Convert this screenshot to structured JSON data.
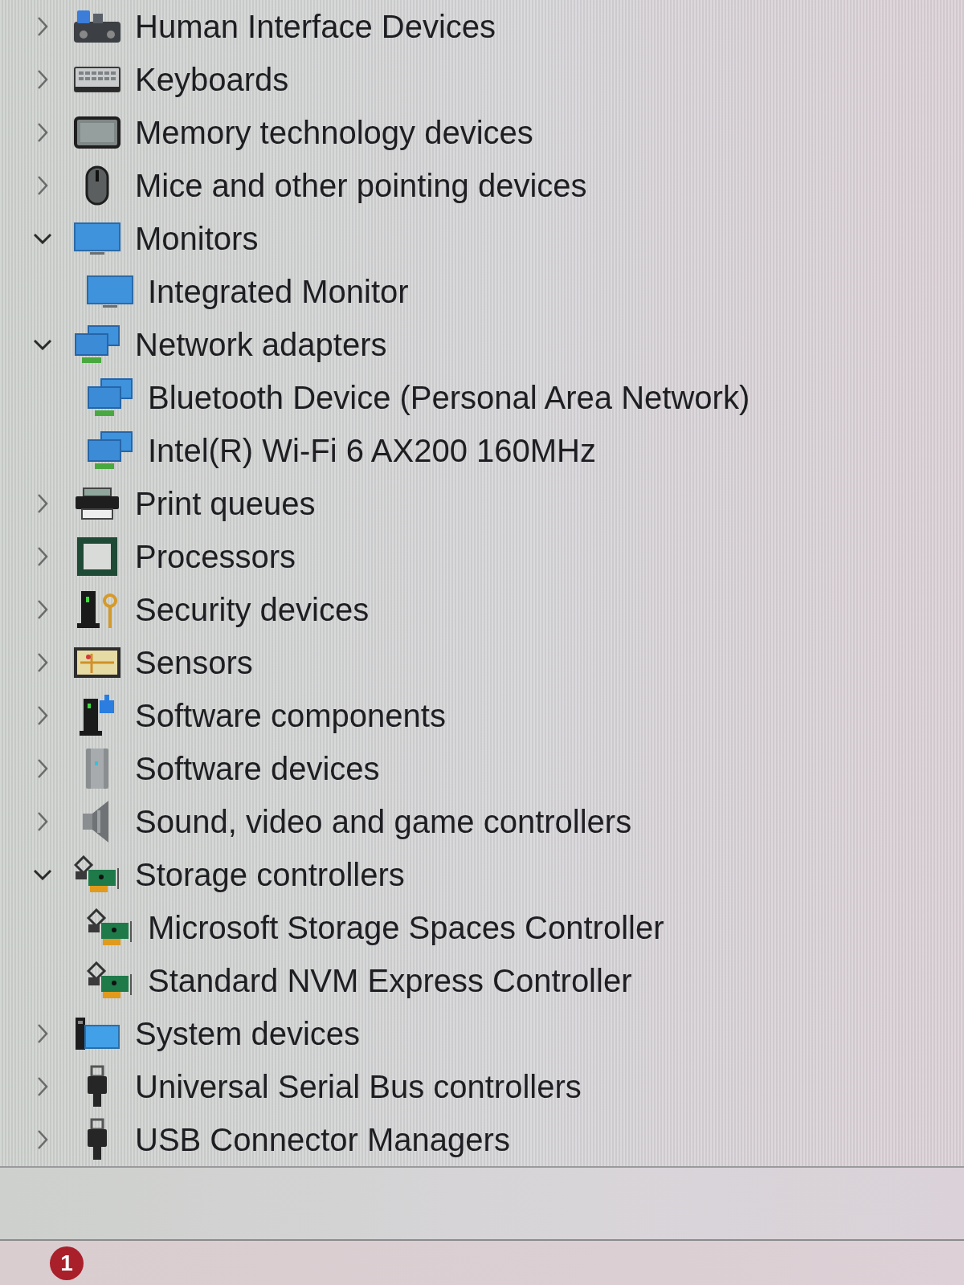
{
  "tree": {
    "items": [
      {
        "kind": "hid",
        "label": "Human Interface Devices",
        "expanded": false
      },
      {
        "kind": "keyboard",
        "label": "Keyboards",
        "expanded": false
      },
      {
        "kind": "memory",
        "label": "Memory technology devices",
        "expanded": false
      },
      {
        "kind": "mouse",
        "label": "Mice and other pointing devices",
        "expanded": false
      },
      {
        "kind": "monitor",
        "label": "Monitors",
        "expanded": true,
        "children": [
          {
            "kind": "monitor",
            "label": "Integrated Monitor"
          }
        ]
      },
      {
        "kind": "network",
        "label": "Network adapters",
        "expanded": true,
        "children": [
          {
            "kind": "network",
            "label": "Bluetooth Device (Personal Area Network)"
          },
          {
            "kind": "network",
            "label": "Intel(R) Wi-Fi 6 AX200 160MHz"
          }
        ]
      },
      {
        "kind": "printer",
        "label": "Print queues",
        "expanded": false
      },
      {
        "kind": "processor",
        "label": "Processors",
        "expanded": false
      },
      {
        "kind": "security",
        "label": "Security devices",
        "expanded": false
      },
      {
        "kind": "sensor",
        "label": "Sensors",
        "expanded": false
      },
      {
        "kind": "component",
        "label": "Software components",
        "expanded": false
      },
      {
        "kind": "software",
        "label": "Software devices",
        "expanded": false
      },
      {
        "kind": "sound",
        "label": "Sound, video and game controllers",
        "expanded": false
      },
      {
        "kind": "storage",
        "label": "Storage controllers",
        "expanded": true,
        "children": [
          {
            "kind": "storage",
            "label": "Microsoft Storage Spaces Controller"
          },
          {
            "kind": "storage",
            "label": "Standard NVM Express Controller"
          }
        ]
      },
      {
        "kind": "system",
        "label": "System devices",
        "expanded": false
      },
      {
        "kind": "usb",
        "label": "Universal Serial Bus controllers",
        "expanded": false
      },
      {
        "kind": "usb",
        "label": "USB Connector Managers",
        "expanded": false
      }
    ]
  },
  "taskbar": {
    "badge": "1"
  }
}
